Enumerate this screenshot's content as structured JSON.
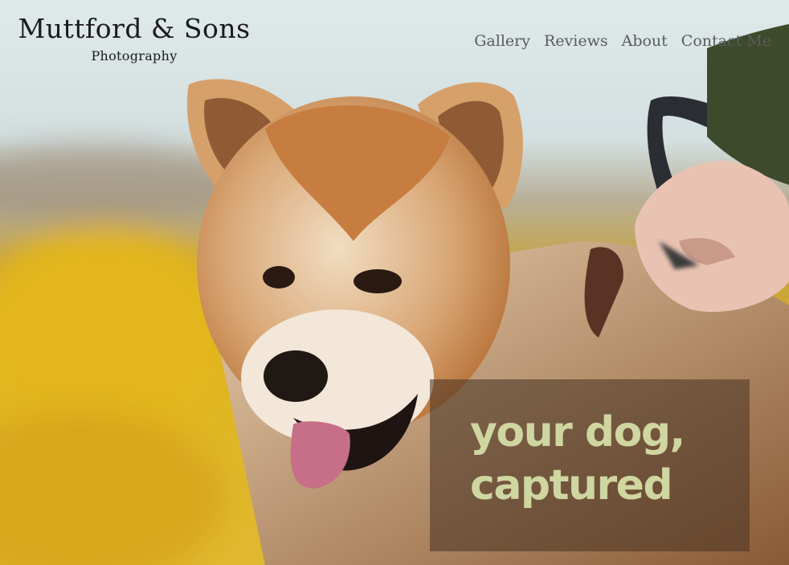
{
  "brand": {
    "title": "Muttford & Sons",
    "subtitle": "Photography"
  },
  "nav": {
    "items": [
      {
        "label": "Gallery"
      },
      {
        "label": "Reviews"
      },
      {
        "label": "About"
      },
      {
        "label": "Contact Me"
      }
    ]
  },
  "hero": {
    "image_subject": "akita dog on leash in field",
    "tagline_line1": "your dog,",
    "tagline_line2": "captured"
  },
  "colors": {
    "tagline_text": "#cfd6a0",
    "nav_text": "#5b5b5b",
    "brand_text": "#1b1b1b",
    "field_yellow": "#d9b21d",
    "dog_orange": "#c97a3a"
  }
}
